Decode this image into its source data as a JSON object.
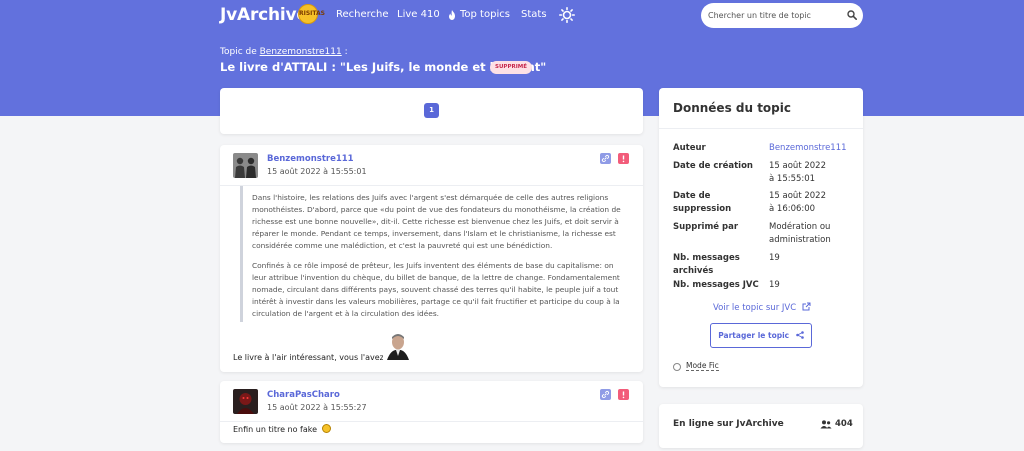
{
  "nav": {
    "brand": "JvArchive",
    "brand_badge": "RISITAS",
    "links": {
      "search": "Recherche",
      "live": "Live 410",
      "top": "Top topics",
      "stats": "Stats"
    },
    "search_placeholder": "Chercher un titre de topic",
    "icons": {
      "top": "flame-icon",
      "theme": "sun-icon",
      "search": "search-icon"
    }
  },
  "topic": {
    "crumb_prefix": "Topic de",
    "author": "Benzemonstre111",
    "crumb_suffix": ":",
    "title": "Le livre d'ATTALI : \"Les Juifs, le monde et l'argent\"",
    "status_badge": "SUPPRIMÉ"
  },
  "pagination": {
    "current_page": "1"
  },
  "posts": [
    {
      "author": "Benzemonstre111",
      "date": "15 août 2022 à 15:55:01",
      "quote_paragraphs": [
        "Dans l'histoire, les relations des Juifs avec l'argent s'est démarquée de celle des autres religions monothéistes. D'abord, parce que «du point de vue des fondateurs du monothéisme, la création de richesse est une bonne nouvelle», dit-il. Cette richesse est bienvenue chez les Juifs, et doit servir à réparer le monde. Pendant ce temps, inversement, dans l'Islam et le christianisme, la richesse est considérée comme une malédiction, et c'est la pauvreté qui est une bénédiction.",
        "Confinés à ce rôle imposé de prêteur, les Juifs inventent des éléments de base du capitalisme: on leur attribue l'invention du chèque, du billet de banque, de la lettre de change. Fondamentalement nomade, circulant dans différents pays, souvent chassé des terres qu'il habite, le peuple juif a tout intérêt à investir dans les valeurs mobilières, partage ce qu'il fait fructifier et participe du coup à la circulation de l'argent et à la circulation des idées."
      ],
      "text": "Le livre à l'air intéressant, vous l'avez lu ?"
    },
    {
      "author": "CharaPasCharo",
      "date": "15 août 2022 à 15:55:27",
      "text": "Enfin un titre no fake"
    }
  ],
  "sidebar": {
    "title": "Données du topic",
    "rows": [
      {
        "label": "Auteur",
        "value": "Benzemonstre111"
      },
      {
        "label": "Date de création",
        "value": "15 août 2022 à 15:55:01"
      },
      {
        "label": "Date de suppression",
        "value": "15 août 2022 à 16:06:00"
      },
      {
        "label": "Supprimé par",
        "value": "Modération ou administration"
      },
      {
        "label": "Nb. messages archivés",
        "value": "19"
      },
      {
        "label": "Nb. messages JVC",
        "value": "19"
      }
    ],
    "jvc_link": "Voir le topic sur JVC",
    "share_button": "Partager le topic",
    "mode_fic": "Mode Fic"
  },
  "online": {
    "title": "En ligne sur JvArchive",
    "count": "404"
  },
  "colors": {
    "header": "#6271dd",
    "accent": "#5a68d8",
    "danger": "#f25c7a",
    "badge_bg": "#fde1e6"
  }
}
